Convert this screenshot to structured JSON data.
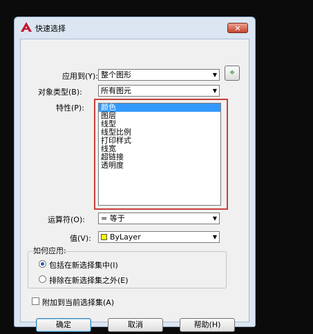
{
  "window": {
    "title": "快速选择",
    "close_label": "✕"
  },
  "apply_to": {
    "label": "应用到(Y):",
    "value": "整个图形"
  },
  "object_type": {
    "label": "对象类型(B):",
    "value": "所有图元"
  },
  "properties": {
    "label": "特性(P):",
    "items": [
      "颜色",
      "图层",
      "线型",
      "线型比例",
      "打印样式",
      "线宽",
      "超链接",
      "透明度"
    ],
    "selected_index": 0
  },
  "operator": {
    "label": "运算符(O):",
    "value": "= 等于"
  },
  "value": {
    "label": "值(V):",
    "value": "ByLayer",
    "swatch_color": "#ffff00"
  },
  "how_to_apply": {
    "label": "如何应用:",
    "options": [
      "包括在新选择集中(I)",
      "排除在新选择集之外(E)"
    ],
    "selected_index": 0
  },
  "append": {
    "label": "附加到当前选择集(A)",
    "checked": false
  },
  "buttons": {
    "ok": "确定",
    "cancel": "取消",
    "help": "帮助(H)"
  },
  "colors": {
    "highlight_frame": "#c8403c",
    "selection": "#3399ff",
    "dialog_bg": "#dbe6f2"
  }
}
